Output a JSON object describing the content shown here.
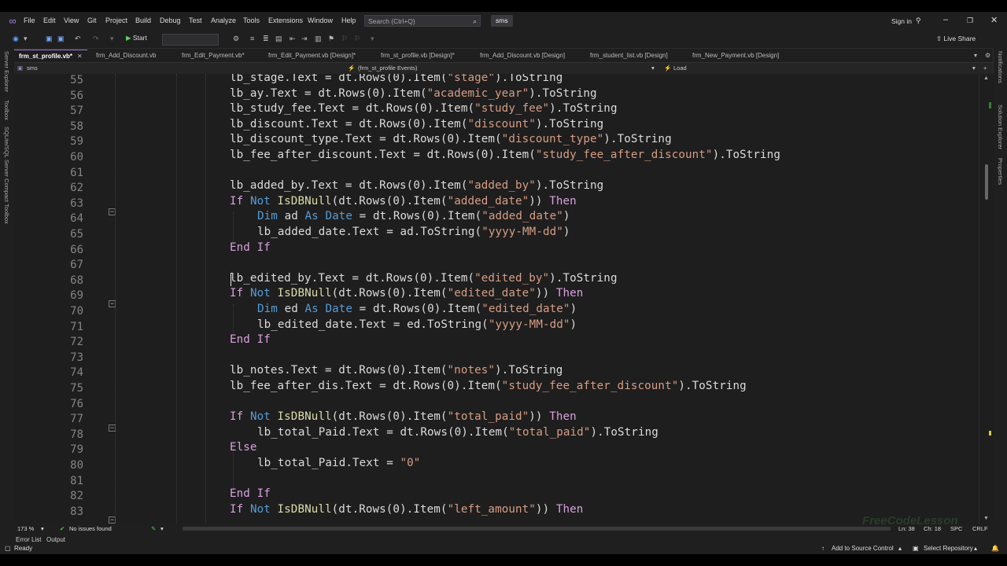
{
  "menubar": {
    "items": [
      "File",
      "Edit",
      "View",
      "Git",
      "Project",
      "Build",
      "Debug",
      "Test",
      "Analyze",
      "Tools",
      "Extensions",
      "Window",
      "Help"
    ],
    "search_placeholder": "Search (Ctrl+Q)",
    "solution_name": "sms",
    "sign_in": "Sign in"
  },
  "toolbar": {
    "start_label": "Start",
    "live_share": "Live Share"
  },
  "left_rail": [
    "Server Explorer",
    "Toolbox",
    "SQLite/SQL Server Compact Toolbox"
  ],
  "right_rail": [
    "Notifications",
    "Solution Explorer",
    "Properties"
  ],
  "tabs": [
    {
      "label": "frm_st_profile.vb*",
      "active": true
    },
    {
      "label": "frm_Add_Discount.vb"
    },
    {
      "label": "frm_Edit_Payment.vb*"
    },
    {
      "label": "frm_Edit_Payment.vb [Design]*"
    },
    {
      "label": "frm_st_profile.vb [Design]*"
    },
    {
      "label": "frm_Add_Discount.vb [Design]"
    },
    {
      "label": "frm_student_list.vb [Design]"
    },
    {
      "label": "frm_New_Payment.vb [Design]"
    }
  ],
  "navbar": {
    "project": "sms",
    "object": "(frm_st_profile Events)",
    "member": "Load"
  },
  "code": {
    "line_numbers": [
      "55",
      "56",
      "57",
      "58",
      "59",
      "60",
      "61",
      "62",
      "63",
      "64",
      "65",
      "66",
      "67",
      "68",
      "69",
      "70",
      "71",
      "72",
      "73",
      "74",
      "75",
      "76",
      "77",
      "78",
      "79",
      "80",
      "81",
      "82",
      "83"
    ]
  },
  "editor_status": {
    "zoom": "173 %",
    "issues": "No issues found",
    "ln": "Ln: 38",
    "ch": "Ch: 18",
    "spc": "SPC",
    "crlf": "CRLF"
  },
  "bottom_tabs": [
    "Error List",
    "Output"
  ],
  "statusbar": {
    "ready": "Ready",
    "source_control": "Add to Source Control",
    "repository": "Select Repository"
  },
  "watermark": "FreeCodeLesson"
}
